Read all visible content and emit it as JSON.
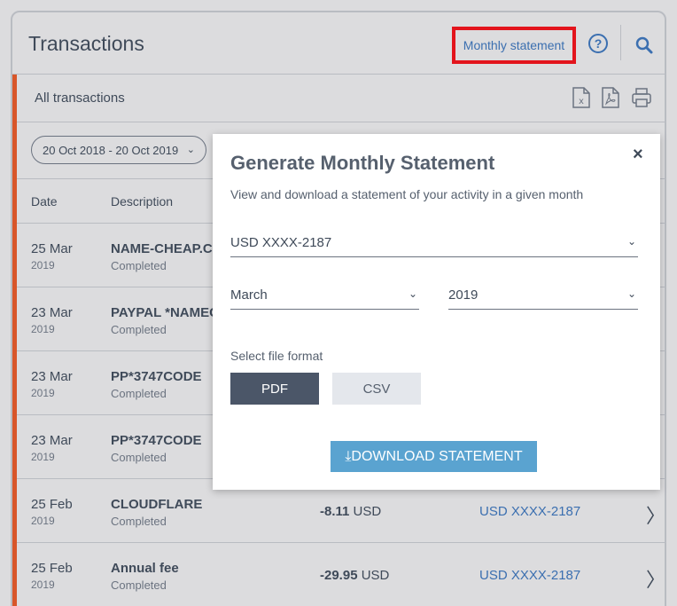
{
  "header": {
    "title": "Transactions",
    "monthly_statement_label": "Monthly statement",
    "help_label": "?"
  },
  "subheader": {
    "label": "All transactions",
    "export_icons": [
      "excel-file-icon",
      "pdf-file-icon",
      "print-icon"
    ]
  },
  "filter": {
    "date_range": "20 Oct 2018 - 20 Oct 2019"
  },
  "columns": {
    "date": "Date",
    "description": "Description"
  },
  "rows": [
    {
      "day": "25 Mar",
      "year": "2019",
      "name": "NAME-CHEAP.COM",
      "status": "Completed",
      "amount": "",
      "currency": "",
      "account": ""
    },
    {
      "day": "23 Mar",
      "year": "2019",
      "name": "PAYPAL *NAMECHEAP",
      "status": "Completed",
      "amount": "",
      "currency": "",
      "account": ""
    },
    {
      "day": "23 Mar",
      "year": "2019",
      "name": "PP*3747CODE",
      "status": "Completed",
      "amount": "",
      "currency": "",
      "account": ""
    },
    {
      "day": "23 Mar",
      "year": "2019",
      "name": "PP*3747CODE",
      "status": "Completed",
      "amount": "",
      "currency": "",
      "account": ""
    },
    {
      "day": "25 Feb",
      "year": "2019",
      "name": "CLOUDFLARE",
      "status": "Completed",
      "amount": "-8.11",
      "currency": "USD",
      "account": "USD XXXX-2187"
    },
    {
      "day": "25 Feb",
      "year": "2019",
      "name": "Annual fee",
      "status": "Completed",
      "amount": "-29.95",
      "currency": "USD",
      "account": "USD XXXX-2187"
    }
  ],
  "modal": {
    "title": "Generate Monthly Statement",
    "close_label": "×",
    "description": "View and download a statement of your activity in a given month",
    "account_value": "USD XXXX-2187",
    "month_value": "March",
    "year_value": "2019",
    "format_label": "Select file format",
    "format_pdf": "PDF",
    "format_csv": "CSV",
    "selected_format": "PDF",
    "download_label": "⤓DOWNLOAD STATEMENT"
  },
  "colors": {
    "accent": "#d8562a",
    "link": "#3b6fb0",
    "highlight": "#e3141c",
    "download": "#5aa3d0"
  }
}
